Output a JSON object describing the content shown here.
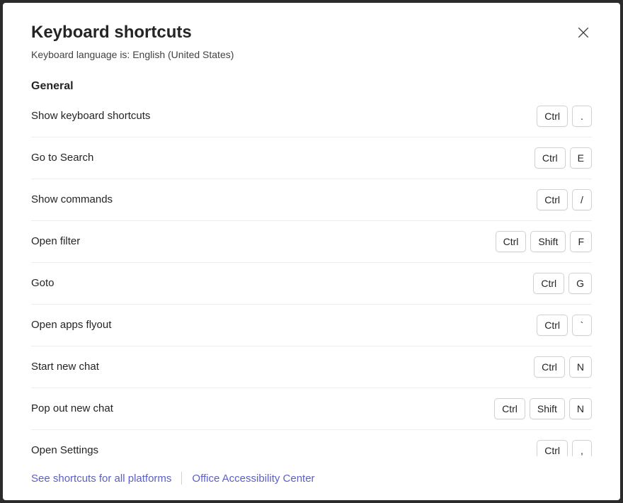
{
  "dialog": {
    "title": "Keyboard shortcuts",
    "subtitle": "Keyboard language is: English (United States)"
  },
  "section": {
    "title": "General",
    "shortcuts": [
      {
        "label": "Show keyboard shortcuts",
        "keys": [
          "Ctrl",
          "."
        ]
      },
      {
        "label": "Go to Search",
        "keys": [
          "Ctrl",
          "E"
        ]
      },
      {
        "label": "Show commands",
        "keys": [
          "Ctrl",
          "/"
        ]
      },
      {
        "label": "Open filter",
        "keys": [
          "Ctrl",
          "Shift",
          "F"
        ]
      },
      {
        "label": "Goto",
        "keys": [
          "Ctrl",
          "G"
        ]
      },
      {
        "label": "Open apps flyout",
        "keys": [
          "Ctrl",
          "`"
        ]
      },
      {
        "label": "Start new chat",
        "keys": [
          "Ctrl",
          "N"
        ]
      },
      {
        "label": "Pop out new chat",
        "keys": [
          "Ctrl",
          "Shift",
          "N"
        ]
      },
      {
        "label": "Open Settings",
        "keys": [
          "Ctrl",
          ","
        ]
      }
    ]
  },
  "footer": {
    "link_all_platforms": "See shortcuts for all platforms",
    "link_accessibility": "Office Accessibility Center"
  }
}
